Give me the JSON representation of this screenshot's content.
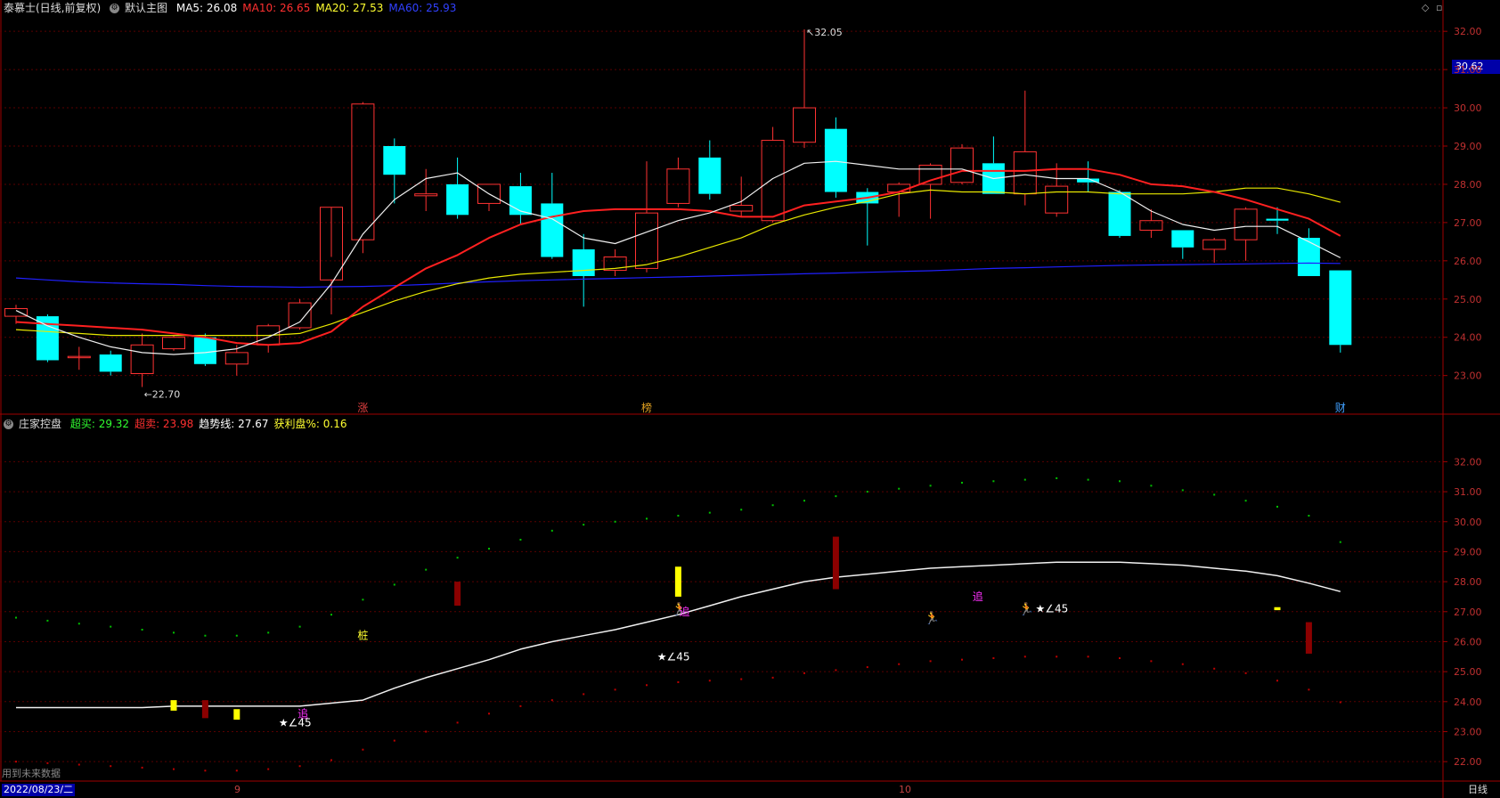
{
  "upper": {
    "title": "泰慕士(日线,前复权)",
    "template": "默认主图",
    "indicators": [
      {
        "label": "MA5: 26.08",
        "color": "#ffffff"
      },
      {
        "label": "MA10: 26.65",
        "color": "#ff3030"
      },
      {
        "label": "MA20: 27.53",
        "color": "#ffff30"
      },
      {
        "label": "MA60: 25.93",
        "color": "#3040ff"
      }
    ],
    "current_price": "30.62",
    "high_label": "32.05",
    "low_label": "22.70",
    "markers": [
      {
        "text": "涨",
        "color": "#e04040",
        "i": 11
      },
      {
        "text": "榜",
        "color": "#e0a020",
        "i": 20
      },
      {
        "text": "财",
        "color": "#40a0ff",
        "i": 42
      }
    ]
  },
  "lower": {
    "title": "庄家控盘",
    "indicators": [
      {
        "label": "超买: 29.32",
        "color": "#30ff30"
      },
      {
        "label": "超卖: 23.98",
        "color": "#ff3030"
      },
      {
        "label": "趋势线: 27.67",
        "color": "#ffffff"
      },
      {
        "label": "获利盘%: 0.16",
        "color": "#ffff30"
      }
    ],
    "texts": [
      {
        "text": "桩",
        "color": "#ffff30",
        "i": 11,
        "v": 26.2
      },
      {
        "text": "★∠45",
        "color": "#ffffff",
        "i": 8.5,
        "v": 23.3
      },
      {
        "text": "追",
        "color": "#ff30ff",
        "i": 9.1,
        "v": 23.6
      },
      {
        "text": "★∠45",
        "color": "#ffffff",
        "i": 20.5,
        "v": 25.5
      },
      {
        "text": "追",
        "color": "#ff30ff",
        "i": 21.2,
        "v": 27.0
      },
      {
        "text": "追",
        "color": "#ff30ff",
        "i": 30.5,
        "v": 27.5
      },
      {
        "text": "★∠45",
        "color": "#ffffff",
        "i": 32.5,
        "v": 27.1
      }
    ],
    "runner_icons": [
      {
        "i": 21,
        "v": 27.1
      },
      {
        "i": 29,
        "v": 26.8
      },
      {
        "i": 32,
        "v": 27.1
      }
    ]
  },
  "footer": {
    "note": "用到未来数据",
    "date": "2022/08/23/二",
    "month_9": "9",
    "month_10": "10",
    "period": "日线"
  },
  "chart_data": {
    "type": "candlestick",
    "upper_axis": {
      "ylim": [
        22.2,
        32.4
      ],
      "ticks": [
        23,
        24,
        25,
        26,
        27,
        28,
        29,
        30,
        31,
        32
      ]
    },
    "lower_axis": {
      "ylim": [
        21.5,
        33.2
      ],
      "ticks": [
        22,
        23,
        24,
        25,
        26,
        27,
        28,
        29,
        30,
        31,
        32
      ]
    },
    "candles": [
      {
        "o": 24.55,
        "h": 24.85,
        "l": 24.35,
        "c": 24.75
      },
      {
        "o": 24.55,
        "h": 24.6,
        "l": 23.35,
        "c": 23.4
      },
      {
        "o": 23.5,
        "h": 23.75,
        "l": 23.15,
        "c": 23.5
      },
      {
        "o": 23.55,
        "h": 23.65,
        "l": 23.0,
        "c": 23.1
      },
      {
        "o": 23.05,
        "h": 24.1,
        "l": 22.7,
        "c": 23.8
      },
      {
        "o": 23.7,
        "h": 24.05,
        "l": 23.65,
        "c": 24.0
      },
      {
        "o": 24.0,
        "h": 24.1,
        "l": 23.25,
        "c": 23.3
      },
      {
        "o": 23.3,
        "h": 23.8,
        "l": 23.0,
        "c": 23.6
      },
      {
        "o": 23.8,
        "h": 24.35,
        "l": 23.6,
        "c": 24.3
      },
      {
        "o": 24.25,
        "h": 25.0,
        "l": 24.2,
        "c": 24.9
      },
      {
        "o": 25.5,
        "h": 26.1,
        "l": 24.6,
        "c": 27.4
      },
      {
        "o": 26.55,
        "h": 30.15,
        "l": 26.2,
        "c": 30.1
      },
      {
        "o": 29.0,
        "h": 29.2,
        "l": 27.5,
        "c": 28.25
      },
      {
        "o": 27.7,
        "h": 28.4,
        "l": 27.3,
        "c": 27.75
      },
      {
        "o": 28.0,
        "h": 28.7,
        "l": 27.1,
        "c": 27.2
      },
      {
        "o": 27.5,
        "h": 28.0,
        "l": 27.3,
        "c": 28.0
      },
      {
        "o": 27.95,
        "h": 28.3,
        "l": 26.95,
        "c": 27.2
      },
      {
        "o": 27.5,
        "h": 28.3,
        "l": 26.05,
        "c": 26.1
      },
      {
        "o": 26.3,
        "h": 26.7,
        "l": 24.8,
        "c": 25.6
      },
      {
        "o": 25.75,
        "h": 26.3,
        "l": 25.6,
        "c": 26.1
      },
      {
        "o": 25.8,
        "h": 28.6,
        "l": 25.7,
        "c": 27.25
      },
      {
        "o": 27.5,
        "h": 28.7,
        "l": 27.4,
        "c": 28.4
      },
      {
        "o": 28.7,
        "h": 29.15,
        "l": 27.6,
        "c": 27.75
      },
      {
        "o": 27.3,
        "h": 28.2,
        "l": 27.15,
        "c": 27.45
      },
      {
        "o": 27.05,
        "h": 29.5,
        "l": 27.0,
        "c": 29.15
      },
      {
        "o": 29.1,
        "h": 32.05,
        "l": 28.95,
        "c": 30.0
      },
      {
        "o": 29.45,
        "h": 29.75,
        "l": 27.65,
        "c": 27.8
      },
      {
        "o": 27.8,
        "h": 27.9,
        "l": 26.4,
        "c": 27.5
      },
      {
        "o": 27.8,
        "h": 28.05,
        "l": 27.15,
        "c": 28.0
      },
      {
        "o": 28.0,
        "h": 28.55,
        "l": 27.1,
        "c": 28.5
      },
      {
        "o": 28.05,
        "h": 29.05,
        "l": 28.0,
        "c": 28.95
      },
      {
        "o": 28.55,
        "h": 29.25,
        "l": 27.75,
        "c": 27.75
      },
      {
        "o": 27.75,
        "h": 30.45,
        "l": 27.45,
        "c": 28.85
      },
      {
        "o": 27.25,
        "h": 28.55,
        "l": 27.15,
        "c": 27.95
      },
      {
        "o": 28.15,
        "h": 28.6,
        "l": 27.8,
        "c": 28.05
      },
      {
        "o": 27.8,
        "h": 27.85,
        "l": 26.6,
        "c": 26.65
      },
      {
        "o": 26.8,
        "h": 27.35,
        "l": 26.6,
        "c": 27.05
      },
      {
        "o": 26.8,
        "h": 26.8,
        "l": 26.05,
        "c": 26.35
      },
      {
        "o": 26.3,
        "h": 26.6,
        "l": 25.95,
        "c": 26.55
      },
      {
        "o": 26.55,
        "h": 27.4,
        "l": 26.0,
        "c": 27.35
      },
      {
        "o": 27.1,
        "h": 27.4,
        "l": 26.7,
        "c": 27.05
      },
      {
        "o": 26.6,
        "h": 26.85,
        "l": 25.6,
        "c": 25.6
      },
      {
        "o": 25.75,
        "h": 25.75,
        "l": 23.6,
        "c": 23.8
      }
    ],
    "ma5": [
      24.7,
      24.3,
      24.0,
      23.75,
      23.6,
      23.55,
      23.6,
      23.7,
      24.0,
      24.4,
      25.4,
      26.7,
      27.6,
      28.15,
      28.3,
      27.75,
      27.3,
      27.1,
      26.6,
      26.45,
      26.75,
      27.05,
      27.25,
      27.55,
      28.15,
      28.55,
      28.6,
      28.5,
      28.4,
      28.4,
      28.4,
      28.15,
      28.25,
      28.15,
      28.15,
      27.8,
      27.3,
      26.95,
      26.8,
      26.9,
      26.9,
      26.5,
      26.08
    ],
    "ma10": [
      24.4,
      24.35,
      24.3,
      24.25,
      24.2,
      24.1,
      24.0,
      23.85,
      23.8,
      23.85,
      24.15,
      24.8,
      25.3,
      25.8,
      26.15,
      26.6,
      26.95,
      27.15,
      27.3,
      27.35,
      27.35,
      27.35,
      27.3,
      27.15,
      27.15,
      27.45,
      27.55,
      27.65,
      27.8,
      28.1,
      28.35,
      28.35,
      28.35,
      28.4,
      28.4,
      28.25,
      28.0,
      27.95,
      27.8,
      27.6,
      27.35,
      27.1,
      26.65
    ],
    "ma20": [
      24.2,
      24.15,
      24.1,
      24.05,
      24.05,
      24.05,
      24.05,
      24.05,
      24.05,
      24.1,
      24.35,
      24.65,
      24.95,
      25.2,
      25.4,
      25.55,
      25.65,
      25.7,
      25.75,
      25.8,
      25.9,
      26.1,
      26.35,
      26.6,
      26.95,
      27.2,
      27.4,
      27.55,
      27.75,
      27.85,
      27.8,
      27.8,
      27.75,
      27.8,
      27.8,
      27.75,
      27.75,
      27.75,
      27.8,
      27.9,
      27.9,
      27.75,
      27.53
    ],
    "ma60": [
      25.55,
      25.5,
      25.45,
      25.42,
      25.4,
      25.38,
      25.35,
      25.33,
      25.32,
      25.31,
      25.32,
      25.33,
      25.35,
      25.38,
      25.42,
      25.45,
      25.48,
      25.5,
      25.52,
      25.54,
      25.56,
      25.58,
      25.6,
      25.62,
      25.64,
      25.66,
      25.68,
      25.7,
      25.72,
      25.74,
      25.77,
      25.8,
      25.82,
      25.84,
      25.86,
      25.88,
      25.89,
      25.9,
      25.91,
      25.92,
      25.93,
      25.94,
      25.93
    ],
    "trend": [
      23.8,
      23.8,
      23.8,
      23.8,
      23.8,
      23.85,
      23.85,
      23.85,
      23.85,
      23.85,
      23.95,
      24.05,
      24.45,
      24.8,
      25.1,
      25.4,
      25.75,
      26.0,
      26.2,
      26.4,
      26.65,
      26.9,
      27.2,
      27.5,
      27.75,
      28.0,
      28.15,
      28.25,
      28.35,
      28.45,
      28.5,
      28.55,
      28.6,
      28.65,
      28.65,
      28.65,
      28.6,
      28.55,
      28.45,
      28.35,
      28.2,
      27.95,
      27.67
    ],
    "overbought": [
      26.8,
      26.7,
      26.6,
      26.5,
      26.4,
      26.3,
      26.2,
      26.2,
      26.3,
      26.5,
      26.9,
      27.4,
      27.9,
      28.4,
      28.8,
      29.1,
      29.4,
      29.7,
      29.9,
      30.0,
      30.1,
      30.2,
      30.3,
      30.4,
      30.55,
      30.7,
      30.85,
      31.0,
      31.1,
      31.2,
      31.3,
      31.35,
      31.4,
      31.45,
      31.4,
      31.35,
      31.2,
      31.05,
      30.9,
      30.7,
      30.5,
      30.2,
      29.32
    ],
    "oversold": [
      22.0,
      21.95,
      21.9,
      21.85,
      21.8,
      21.75,
      21.7,
      21.7,
      21.75,
      21.85,
      22.05,
      22.4,
      22.7,
      23.0,
      23.3,
      23.6,
      23.85,
      24.05,
      24.25,
      24.4,
      24.55,
      24.65,
      24.7,
      24.75,
      24.8,
      24.95,
      25.05,
      25.15,
      25.25,
      25.35,
      25.4,
      25.45,
      25.5,
      25.5,
      25.5,
      25.45,
      25.35,
      25.25,
      25.1,
      24.95,
      24.7,
      24.4,
      23.98
    ],
    "lower_bars": [
      {
        "i": 5,
        "from": 23.7,
        "to": 24.05,
        "color": "#ffff00"
      },
      {
        "i": 6,
        "from": 23.45,
        "to": 24.05,
        "color": "#8b0000"
      },
      {
        "i": 7,
        "from": 23.4,
        "to": 23.75,
        "color": "#ffff00"
      },
      {
        "i": 14,
        "from": 27.2,
        "to": 28.0,
        "color": "#8b0000"
      },
      {
        "i": 21,
        "from": 27.5,
        "to": 28.5,
        "color": "#ffff00"
      },
      {
        "i": 26,
        "from": 27.75,
        "to": 29.5,
        "color": "#8b0000"
      },
      {
        "i": 40,
        "from": 27.05,
        "to": 27.15,
        "color": "#ffff00"
      },
      {
        "i": 41,
        "from": 25.6,
        "to": 26.65,
        "color": "#8b0000"
      }
    ]
  }
}
